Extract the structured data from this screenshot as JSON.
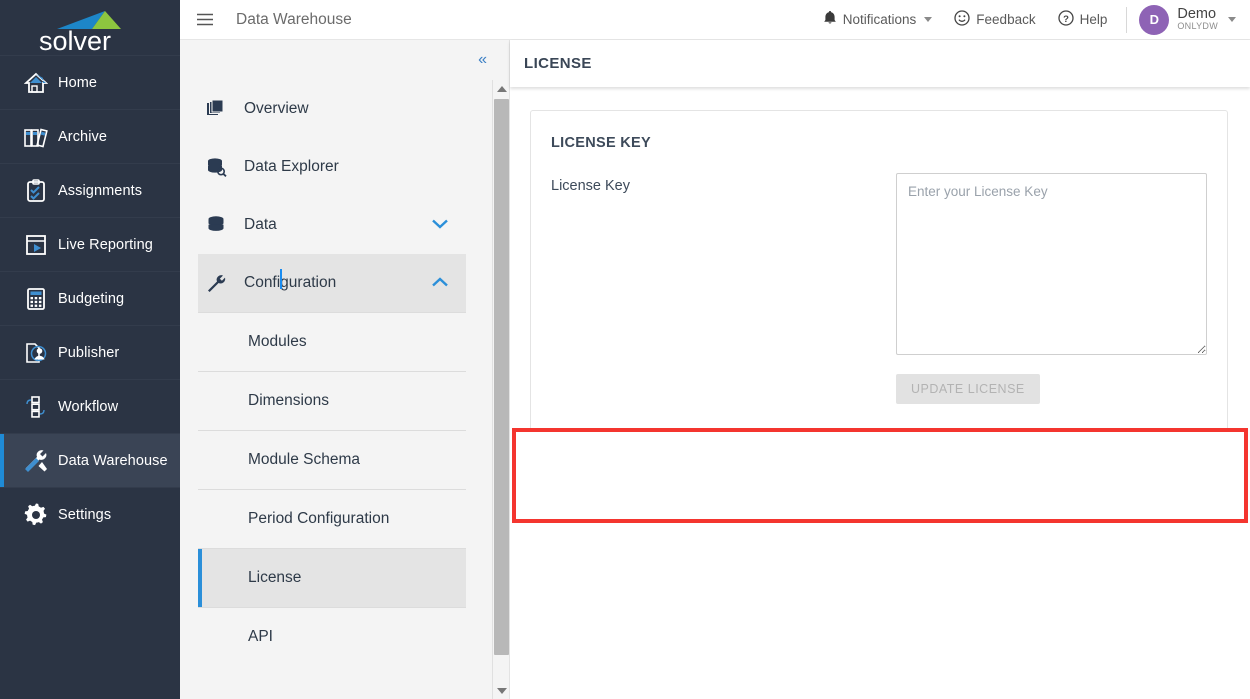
{
  "brand": {
    "name": "solver",
    "logo_blue": "#1d86c8",
    "logo_green": "#8dc63f"
  },
  "colors": {
    "rail_bg": "#2b3444",
    "rail_active": "#3a4455",
    "accent_blue": "#2b8fd9",
    "avatar_purple": "#8e63b5",
    "annotation_red": "#f4352f"
  },
  "rail": {
    "items": [
      {
        "label": "Home",
        "icon": "home-icon",
        "active": false
      },
      {
        "label": "Archive",
        "icon": "archive-icon",
        "active": false
      },
      {
        "label": "Assignments",
        "icon": "clipboard-check-icon",
        "active": false
      },
      {
        "label": "Live Reporting",
        "icon": "play-screen-icon",
        "active": false
      },
      {
        "label": "Budgeting",
        "icon": "calculator-icon",
        "active": false
      },
      {
        "label": "Publisher",
        "icon": "document-user-icon",
        "active": false
      },
      {
        "label": "Workflow",
        "icon": "workflow-nodes-icon",
        "active": false
      },
      {
        "label": "Data Warehouse",
        "icon": "tools-icon",
        "active": true
      },
      {
        "label": "Settings",
        "icon": "gear-icon",
        "active": false
      }
    ]
  },
  "topbar": {
    "menu_icon": "hamburger-icon",
    "title": "Data Warehouse",
    "notifications": {
      "label": "Notifications",
      "icon": "bell-icon"
    },
    "feedback": {
      "label": "Feedback",
      "icon": "smiley-icon"
    },
    "help": {
      "label": "Help",
      "icon": "question-circle-icon"
    },
    "user": {
      "initial": "D",
      "name": "Demo",
      "subtitle": "OnlyDw"
    }
  },
  "subnav": {
    "collapse_icon": "double-chevron-left-icon",
    "items": [
      {
        "label": "Overview",
        "icon": "layers-icon",
        "type": "top",
        "state": "none"
      },
      {
        "label": "Data Explorer",
        "icon": "database-search-icon",
        "type": "top",
        "state": "none"
      },
      {
        "label": "Data",
        "icon": "database-icon",
        "type": "top",
        "state": "collapsed",
        "chevron": "chevron-down-icon"
      },
      {
        "label": "Configuration",
        "icon": "wrench-icon",
        "type": "top",
        "state": "expanded",
        "chevron": "chevron-up-icon"
      },
      {
        "label": "Modules",
        "type": "sub",
        "state": "none"
      },
      {
        "label": "Dimensions",
        "type": "sub",
        "state": "none"
      },
      {
        "label": "Module Schema",
        "type": "sub",
        "state": "none"
      },
      {
        "label": "Period Configuration",
        "type": "sub",
        "state": "none"
      },
      {
        "label": "License",
        "type": "sub",
        "state": "selected"
      },
      {
        "label": "API",
        "type": "sub",
        "state": "none"
      }
    ],
    "scrollbar": {
      "up_icon": "scroll-up-arrow-icon",
      "down_icon": "scroll-down-arrow-icon"
    }
  },
  "main": {
    "page_title": "LICENSE",
    "card": {
      "title": "LICENSE KEY",
      "field_label": "License Key",
      "textarea_placeholder": "Enter your License Key",
      "textarea_value": "",
      "button_label": "UPDATE LICENSE",
      "button_disabled": true
    }
  },
  "annotation": {
    "type": "highlight-rectangle",
    "color": "#f4352f"
  }
}
